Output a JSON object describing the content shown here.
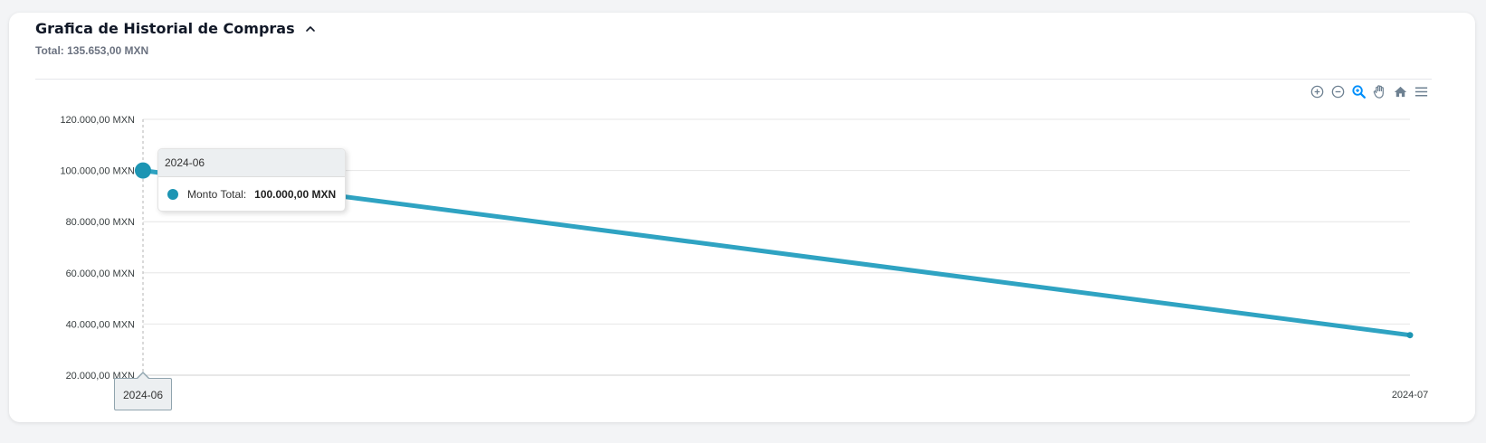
{
  "header": {
    "title": "Grafica de Historial de Compras",
    "total": "Total: 135.653,00 MXN"
  },
  "toolbar": {
    "icons": [
      "zoom-in-icon",
      "zoom-out-icon",
      "zoom-selection-icon",
      "pan-hand-icon",
      "home-reset-icon",
      "menu-icon"
    ]
  },
  "tooltip": {
    "title": "2024-06",
    "series_label": "Monto Total:",
    "value": "100.000,00 MXN"
  },
  "xaxis_tooltip": "2024-06",
  "colors": {
    "series": "#1d95b3",
    "line": "#2fa3c2"
  },
  "chart_data": {
    "type": "line",
    "categories": [
      "2024-06",
      "2024-07"
    ],
    "series": [
      {
        "name": "Monto Total",
        "values": [
          100000,
          35653
        ]
      }
    ],
    "ytick_labels": [
      "120.000,00 MXN",
      "100.000,00 MXN",
      "80.000,00 MXN",
      "60.000,00 MXN",
      "40.000,00 MXN",
      "20.000,00 MXN"
    ],
    "yticks": [
      120000,
      100000,
      80000,
      60000,
      40000,
      20000
    ],
    "ylim": [
      20000,
      120000
    ],
    "grid": true,
    "legend": "none"
  }
}
